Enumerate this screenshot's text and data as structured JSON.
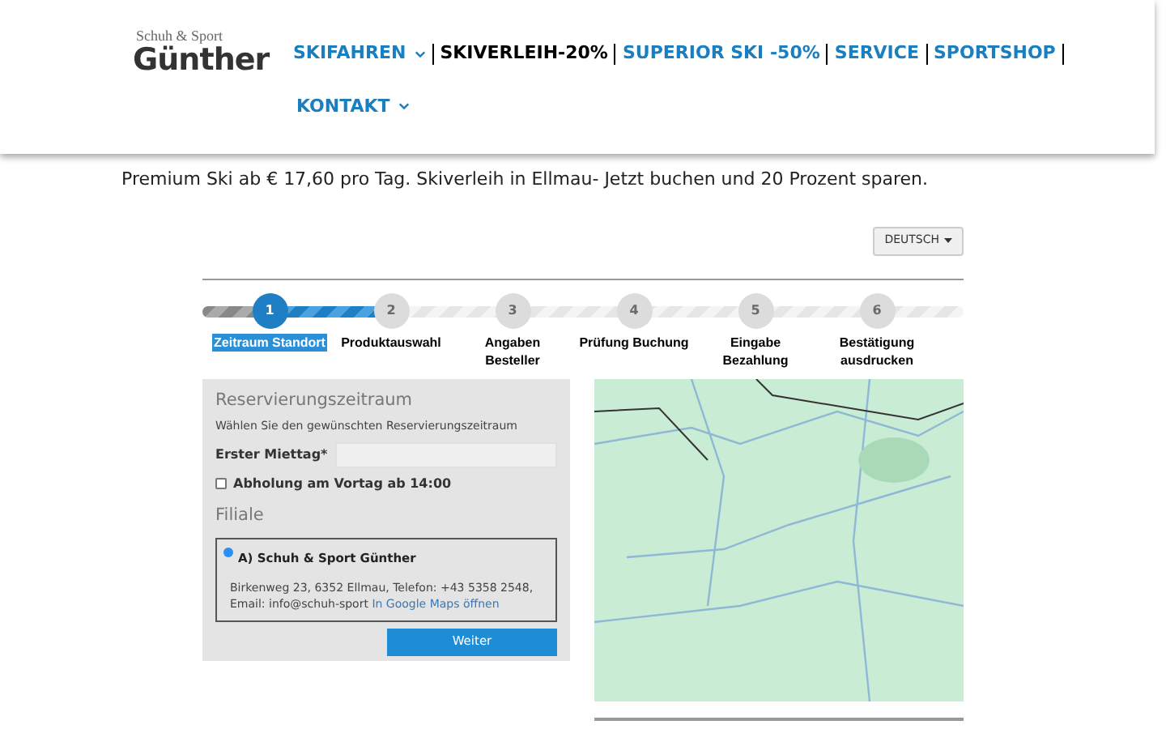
{
  "logo": {
    "top": "Schuh & Sport",
    "name": "Günther"
  },
  "nav": [
    {
      "label": "SKIFAHREN",
      "selected": false,
      "dropdown": true
    },
    {
      "label": "SKIVERLEIH-20%",
      "selected": true,
      "dropdown": false
    },
    {
      "label": "SUPERIOR SKI -50%",
      "selected": false,
      "dropdown": false
    },
    {
      "label": "SERVICE",
      "selected": false,
      "dropdown": false
    },
    {
      "label": "SPORTSHOP",
      "selected": false,
      "dropdown": false
    },
    {
      "label": "KONTAKT",
      "selected": false,
      "dropdown": true
    }
  ],
  "tagline": "Premium Ski ab € 17,60 pro Tag. Skiverleih in Ellmau- Jetzt buchen und 20 Prozent sparen.",
  "language_button": "DEUTSCH",
  "steps": [
    {
      "number": "1",
      "label": "Zeitraum Standort",
      "selected": true
    },
    {
      "number": "2",
      "label": "Produktauswahl",
      "selected": false
    },
    {
      "number": "3",
      "label": "Angaben Besteller",
      "selected": false
    },
    {
      "number": "4",
      "label": "Prüfung Buchung",
      "selected": false
    },
    {
      "number": "5",
      "label": "Eingabe Bezahlung",
      "selected": false
    },
    {
      "number": "6",
      "label": "Bestätigung ausdrucken",
      "selected": false
    }
  ],
  "form": {
    "heading": "Reservierungszeitraum",
    "hint": "Wählen Sie den gewünschten Reservierungszeitraum",
    "first_day": {
      "label": "Erster Miettag*"
    },
    "pickup": {
      "label": "Abholung am Vortag ab 14:00",
      "checked": false
    },
    "branch_heading": "Filiale",
    "branches": [
      {
        "name": "A) Schuh & Sport Günther",
        "selected": true,
        "address": "Birkenweg 23, 6352 Ellmau, Telefon: +43 5358 2548, Email: info@schuh-sport",
        "map_link": "In Google Maps öffnen"
      }
    ],
    "submit": "Weiter"
  }
}
